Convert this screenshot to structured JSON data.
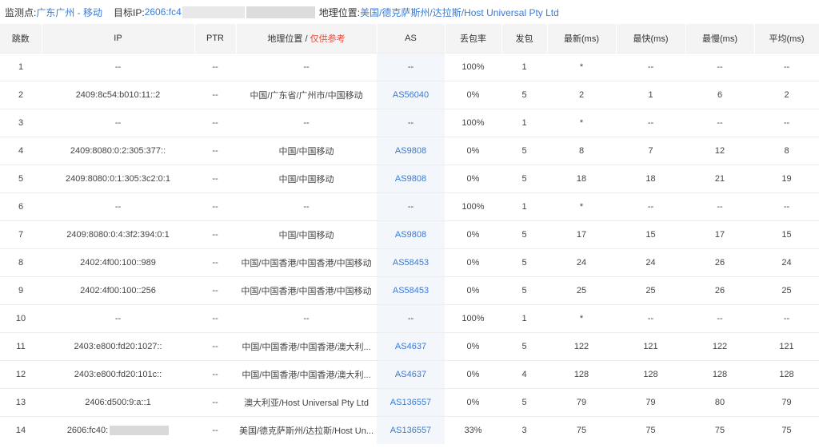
{
  "header": {
    "monitor_label": "监测点:",
    "monitor_value": "广东广州 - 移动",
    "target_label": "目标IP:",
    "target_value": "2606:fc4",
    "geo_label": "地理位置:",
    "geo_value": "美国/德克萨斯州/达拉斯/Host Universal Pty Ltd"
  },
  "table": {
    "columns": {
      "hop": "跳数",
      "ip": "IP",
      "ptr": "PTR",
      "geo": "地理位置 / ",
      "geo_note": "仅供参考",
      "as": "AS",
      "loss": "丢包率",
      "sent": "发包",
      "latest": "最新(ms)",
      "fastest": "最快(ms)",
      "slowest": "最慢(ms)",
      "avg": "平均(ms)"
    },
    "rows": [
      {
        "hop": "1",
        "ip": "--",
        "ptr": "--",
        "geo": "--",
        "as": "--",
        "loss": "100%",
        "sent": "1",
        "latest": "*",
        "fastest": "--",
        "slowest": "--",
        "avg": "--"
      },
      {
        "hop": "2",
        "ip": "2409:8c54:b010:11::2",
        "ptr": "--",
        "geo": "中国/广东省/广州市/中国移动",
        "as": "AS56040",
        "loss": "0%",
        "sent": "5",
        "latest": "2",
        "fastest": "1",
        "slowest": "6",
        "avg": "2"
      },
      {
        "hop": "3",
        "ip": "--",
        "ptr": "--",
        "geo": "--",
        "as": "--",
        "loss": "100%",
        "sent": "1",
        "latest": "*",
        "fastest": "--",
        "slowest": "--",
        "avg": "--"
      },
      {
        "hop": "4",
        "ip": "2409:8080:0:2:305:377::",
        "ptr": "--",
        "geo": "中国/中国移动",
        "as": "AS9808",
        "loss": "0%",
        "sent": "5",
        "latest": "8",
        "fastest": "7",
        "slowest": "12",
        "avg": "8"
      },
      {
        "hop": "5",
        "ip": "2409:8080:0:1:305:3c2:0:1",
        "ptr": "--",
        "geo": "中国/中国移动",
        "as": "AS9808",
        "loss": "0%",
        "sent": "5",
        "latest": "18",
        "fastest": "18",
        "slowest": "21",
        "avg": "19"
      },
      {
        "hop": "6",
        "ip": "--",
        "ptr": "--",
        "geo": "--",
        "as": "--",
        "loss": "100%",
        "sent": "1",
        "latest": "*",
        "fastest": "--",
        "slowest": "--",
        "avg": "--"
      },
      {
        "hop": "7",
        "ip": "2409:8080:0:4:3f2:394:0:1",
        "ptr": "--",
        "geo": "中国/中国移动",
        "as": "AS9808",
        "loss": "0%",
        "sent": "5",
        "latest": "17",
        "fastest": "15",
        "slowest": "17",
        "avg": "15"
      },
      {
        "hop": "8",
        "ip": "2402:4f00:100::989",
        "ptr": "--",
        "geo": "中国/中国香港/中国香港/中国移动",
        "as": "AS58453",
        "loss": "0%",
        "sent": "5",
        "latest": "24",
        "fastest": "24",
        "slowest": "26",
        "avg": "24"
      },
      {
        "hop": "9",
        "ip": "2402:4f00:100::256",
        "ptr": "--",
        "geo": "中国/中国香港/中国香港/中国移动",
        "as": "AS58453",
        "loss": "0%",
        "sent": "5",
        "latest": "25",
        "fastest": "25",
        "slowest": "26",
        "avg": "25"
      },
      {
        "hop": "10",
        "ip": "--",
        "ptr": "--",
        "geo": "--",
        "as": "--",
        "loss": "100%",
        "sent": "1",
        "latest": "*",
        "fastest": "--",
        "slowest": "--",
        "avg": "--"
      },
      {
        "hop": "11",
        "ip": "2403:e800:fd20:1027::",
        "ptr": "--",
        "geo": "中国/中国香港/中国香港/澳大利...",
        "as": "AS4637",
        "loss": "0%",
        "sent": "5",
        "latest": "122",
        "fastest": "121",
        "slowest": "122",
        "avg": "121"
      },
      {
        "hop": "12",
        "ip": "2403:e800:fd20:101c::",
        "ptr": "--",
        "geo": "中国/中国香港/中国香港/澳大利...",
        "as": "AS4637",
        "loss": "0%",
        "sent": "4",
        "latest": "128",
        "fastest": "128",
        "slowest": "128",
        "avg": "128"
      },
      {
        "hop": "13",
        "ip": "2406:d500:9:a::1",
        "ptr": "--",
        "geo": "澳大利亚/Host Universal Pty Ltd",
        "as": "AS136557",
        "loss": "0%",
        "sent": "5",
        "latest": "79",
        "fastest": "79",
        "slowest": "80",
        "avg": "79"
      },
      {
        "hop": "14",
        "ip": "2606:fc40:",
        "ptr": "--",
        "geo": "美国/德克萨斯州/达拉斯/Host Un...",
        "as": "AS136557",
        "loss": "33%",
        "sent": "3",
        "latest": "75",
        "fastest": "75",
        "slowest": "75",
        "avg": "75"
      }
    ]
  }
}
